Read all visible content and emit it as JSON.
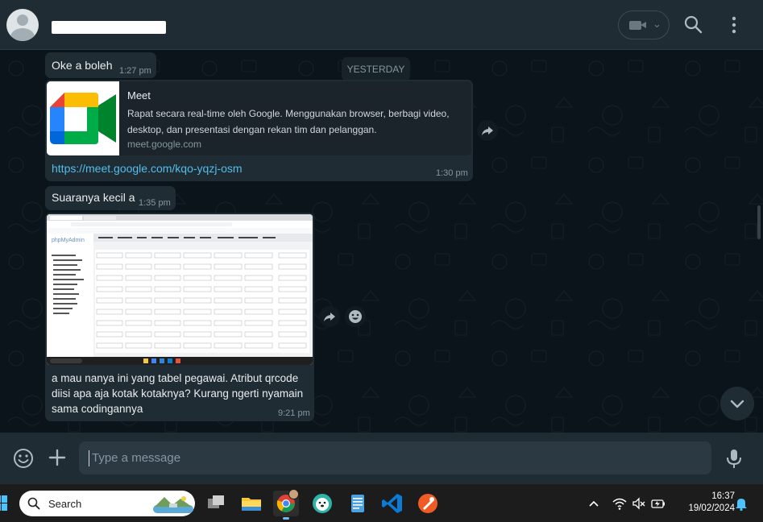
{
  "header": {
    "contact_name": "redacted",
    "video_call_icon": "video-camera-icon",
    "search_icon": "search-icon",
    "menu_icon": "kebab-menu-icon"
  },
  "date_divider": "YESTERDAY",
  "messages": [
    {
      "text": "Oke a boleh",
      "time": "1:27 pm"
    },
    {
      "preview_title": "Meet",
      "preview_description": "Rapat secara real-time oleh Google. Menggunakan browser, berbagi video, desktop, dan presentasi dengan rekan tim dan pelanggan.",
      "preview_domain": "meet.google.com",
      "link": "https://meet.google.com/kqo-yqzj-osm",
      "time": "1:30 pm"
    },
    {
      "text": "Suaranya kecil a",
      "time": "1:35 pm"
    },
    {
      "image": "phpMyAdmin table structure screenshot",
      "caption": "a mau nanya ini yang tabel pegawai. Atribut qrcode diisi apa aja kotak kotaknya? Kurang ngerti nyamain sama codingannya",
      "time": "9:21 pm"
    }
  ],
  "composer": {
    "placeholder": "Type a message"
  },
  "taskbar": {
    "search_label": "Search",
    "time": "16:37",
    "date": "19/02/2024"
  },
  "colors": {
    "chat_bg": "#0b141a",
    "panel": "#202c33",
    "link": "#53bdeb",
    "meta": "#8696a0"
  }
}
